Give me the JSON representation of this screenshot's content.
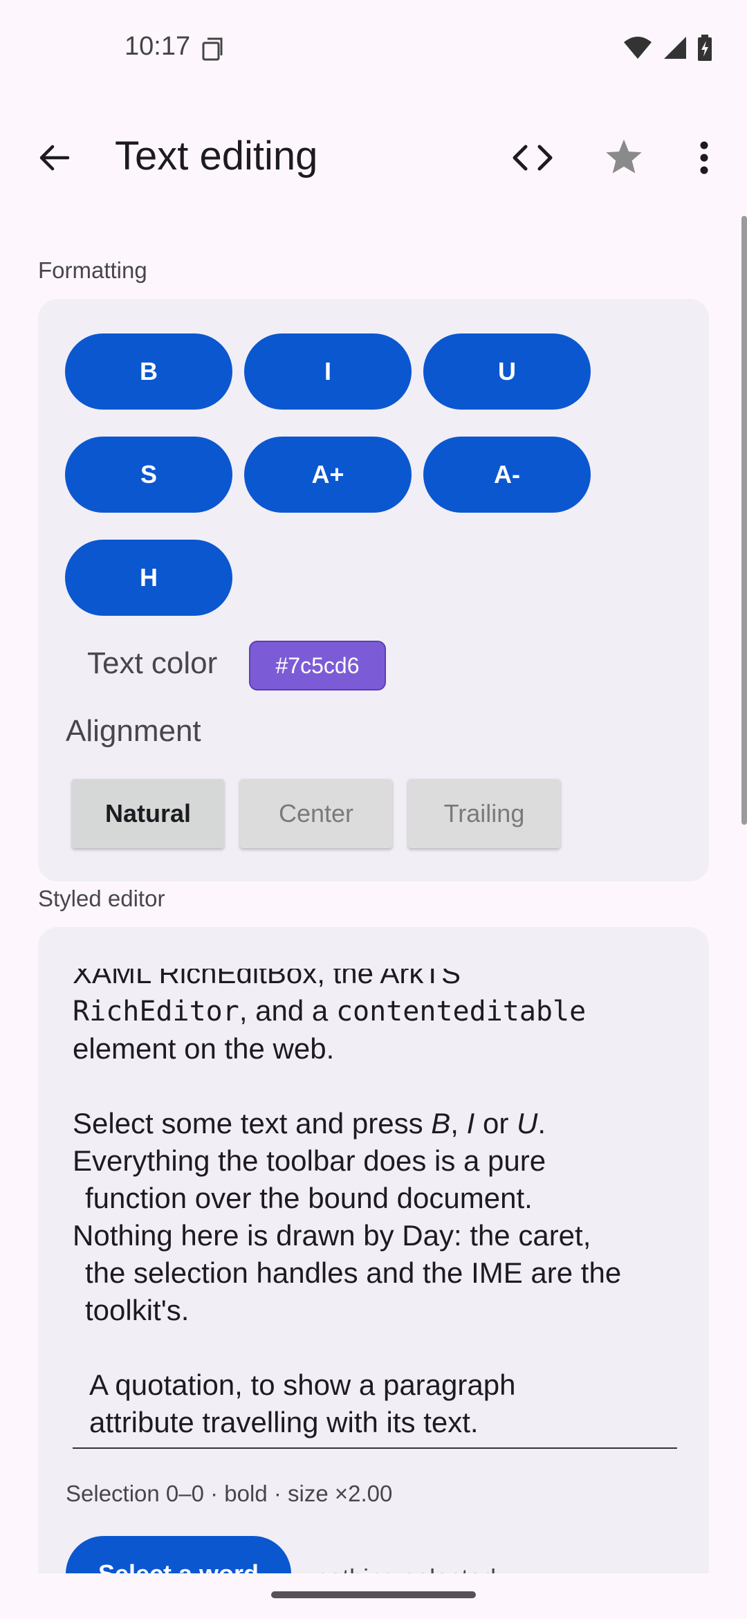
{
  "status_bar": {
    "time": "10:17"
  },
  "app_bar": {
    "title": "Text editing",
    "back_icon": "arrow-back-icon",
    "code_icon": "code-icon",
    "star_icon": "star-icon",
    "more_icon": "more-vert-icon"
  },
  "formatting": {
    "section_label": "Formatting",
    "buttons": [
      "B",
      "I",
      "U",
      "S",
      "A+",
      "A-",
      "H"
    ],
    "text_color_label": "Text color",
    "text_color_value": "#7c5cd6",
    "alignment_label": "Alignment",
    "alignment_options": [
      "Natural",
      "Center",
      "Trailing"
    ],
    "alignment_selected": "Natural"
  },
  "editor": {
    "section_label": "Styled editor",
    "lines": {
      "l0": "XAML RichEditBox, the ArkTS",
      "l1_mono": "RichEditor",
      "l1_mid": ", and a ",
      "l1_mono2": "contenteditable",
      "l2": "element on the web.",
      "l3_a": "Select some text and press ",
      "l3_b": "B",
      "l3_c": ", ",
      "l3_d": "I",
      "l3_e": " or ",
      "l3_f": "U",
      "l3_g": ".",
      "l4": "Everything the toolbar does is a pure",
      "l5": "function over the bound document.",
      "l6": "Nothing here is drawn by Day: the caret,",
      "l7": "the selection handles and the IME are the",
      "l8": "toolkit's.",
      "l9": "A quotation, to show a paragraph",
      "l10": "attribute travelling with its text."
    },
    "selection_status": "Selection 0–0 · bold · size ×2.00",
    "select_word_label": "Select a word",
    "nothing_selected": "nothing selected"
  }
}
